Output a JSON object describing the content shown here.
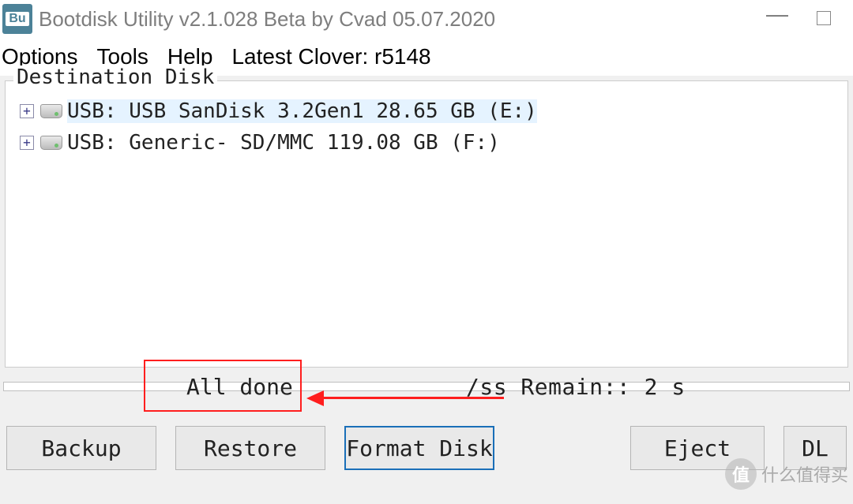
{
  "titlebar": {
    "icon_letters": "Bu",
    "title": "Bootdisk Utility v2.1.028 Beta by Cvad 05.07.2020"
  },
  "menubar": {
    "options": "Options",
    "tools": "Tools",
    "help_first": "H",
    "help_rest": "elp",
    "latest_clover": "Latest Clover: r5148"
  },
  "destination_disk": {
    "legend": "Destination Disk",
    "rows": [
      {
        "label": "USB: USB SanDisk 3.2Gen1 28.65 GB (E:)",
        "selected": true
      },
      {
        "label": "USB: Generic- SD/MMC 119.08 GB (F:)",
        "selected": false
      }
    ]
  },
  "status": {
    "all_done": "All done",
    "remain": "/ss Remain:: 2 s"
  },
  "buttons": {
    "backup": "Backup",
    "restore": "Restore",
    "format_disk": "Format Disk",
    "eject": "Eject",
    "dl": "DL"
  },
  "watermark": {
    "circle": "值",
    "text": "什么值得买"
  }
}
